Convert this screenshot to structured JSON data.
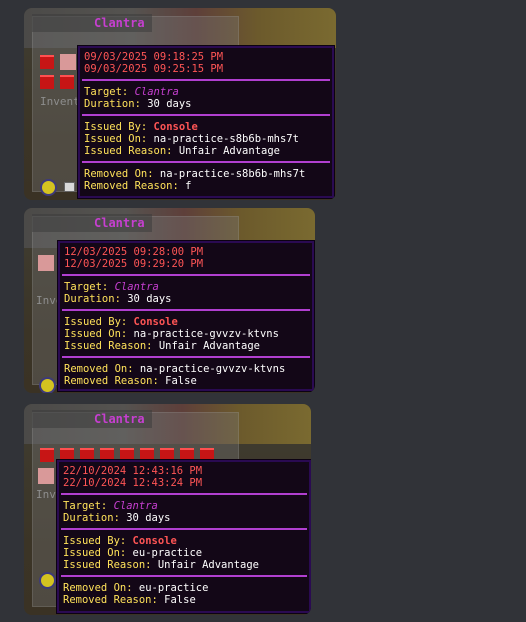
{
  "cards": [
    {
      "title": "Clantra",
      "inventory_label": "Invent",
      "start": "09/03/2025 09:18:25 PM",
      "end": "09/03/2025 09:25:15 PM",
      "target_label": "Target:",
      "target_value": "Clantra",
      "duration_label": "Duration:",
      "duration_value": "30 days",
      "issued_by_label": "Issued By:",
      "issued_by_value": "Console",
      "issued_on_label": "Issued On:",
      "issued_on_value": "na-practice-s8b6b-mhs7t",
      "issued_reason_label": "Issued Reason:",
      "issued_reason_value": "Unfair Advantage",
      "removed_on_label": "Removed On:",
      "removed_on_value": "na-practice-s8b6b-mhs7t",
      "removed_reason_label": "Removed Reason:",
      "removed_reason_value": "f"
    },
    {
      "title": "Clantra",
      "inventory_label": "Inve",
      "start": "12/03/2025 09:28:00 PM",
      "end": "12/03/2025 09:29:20 PM",
      "target_label": "Target:",
      "target_value": "Clantra",
      "duration_label": "Duration:",
      "duration_value": "30 days",
      "issued_by_label": "Issued By:",
      "issued_by_value": "Console",
      "issued_on_label": "Issued On:",
      "issued_on_value": "na-practice-gvvzv-ktvns",
      "issued_reason_label": "Issued Reason:",
      "issued_reason_value": "Unfair Advantage",
      "removed_on_label": "Removed On:",
      "removed_on_value": "na-practice-gvvzv-ktvns",
      "removed_reason_label": "Removed Reason:",
      "removed_reason_value": "False"
    },
    {
      "title": "Clantra",
      "inventory_label": "Inve",
      "start": "22/10/2024 12:43:16 PM",
      "end": "22/10/2024 12:43:24 PM",
      "target_label": "Target:",
      "target_value": "Clantra",
      "duration_label": "Duration:",
      "duration_value": "30 days",
      "issued_by_label": "Issued By:",
      "issued_by_value": "Console",
      "issued_on_label": "Issued On:",
      "issued_on_value": "eu-practice",
      "issued_reason_label": "Issued Reason:",
      "issued_reason_value": "Unfair Advantage",
      "removed_on_label": "Removed On:",
      "removed_on_value": "eu-practice",
      "removed_reason_label": "Removed Reason:",
      "removed_reason_value": "False"
    }
  ],
  "colors": {
    "page_bg": "#313338",
    "tooltip_bg": "#130717",
    "separator": "#b13fd0",
    "date_red": "#ff5555",
    "label_yellow": "#ffe25a",
    "target_purple": "#c63fd0"
  }
}
